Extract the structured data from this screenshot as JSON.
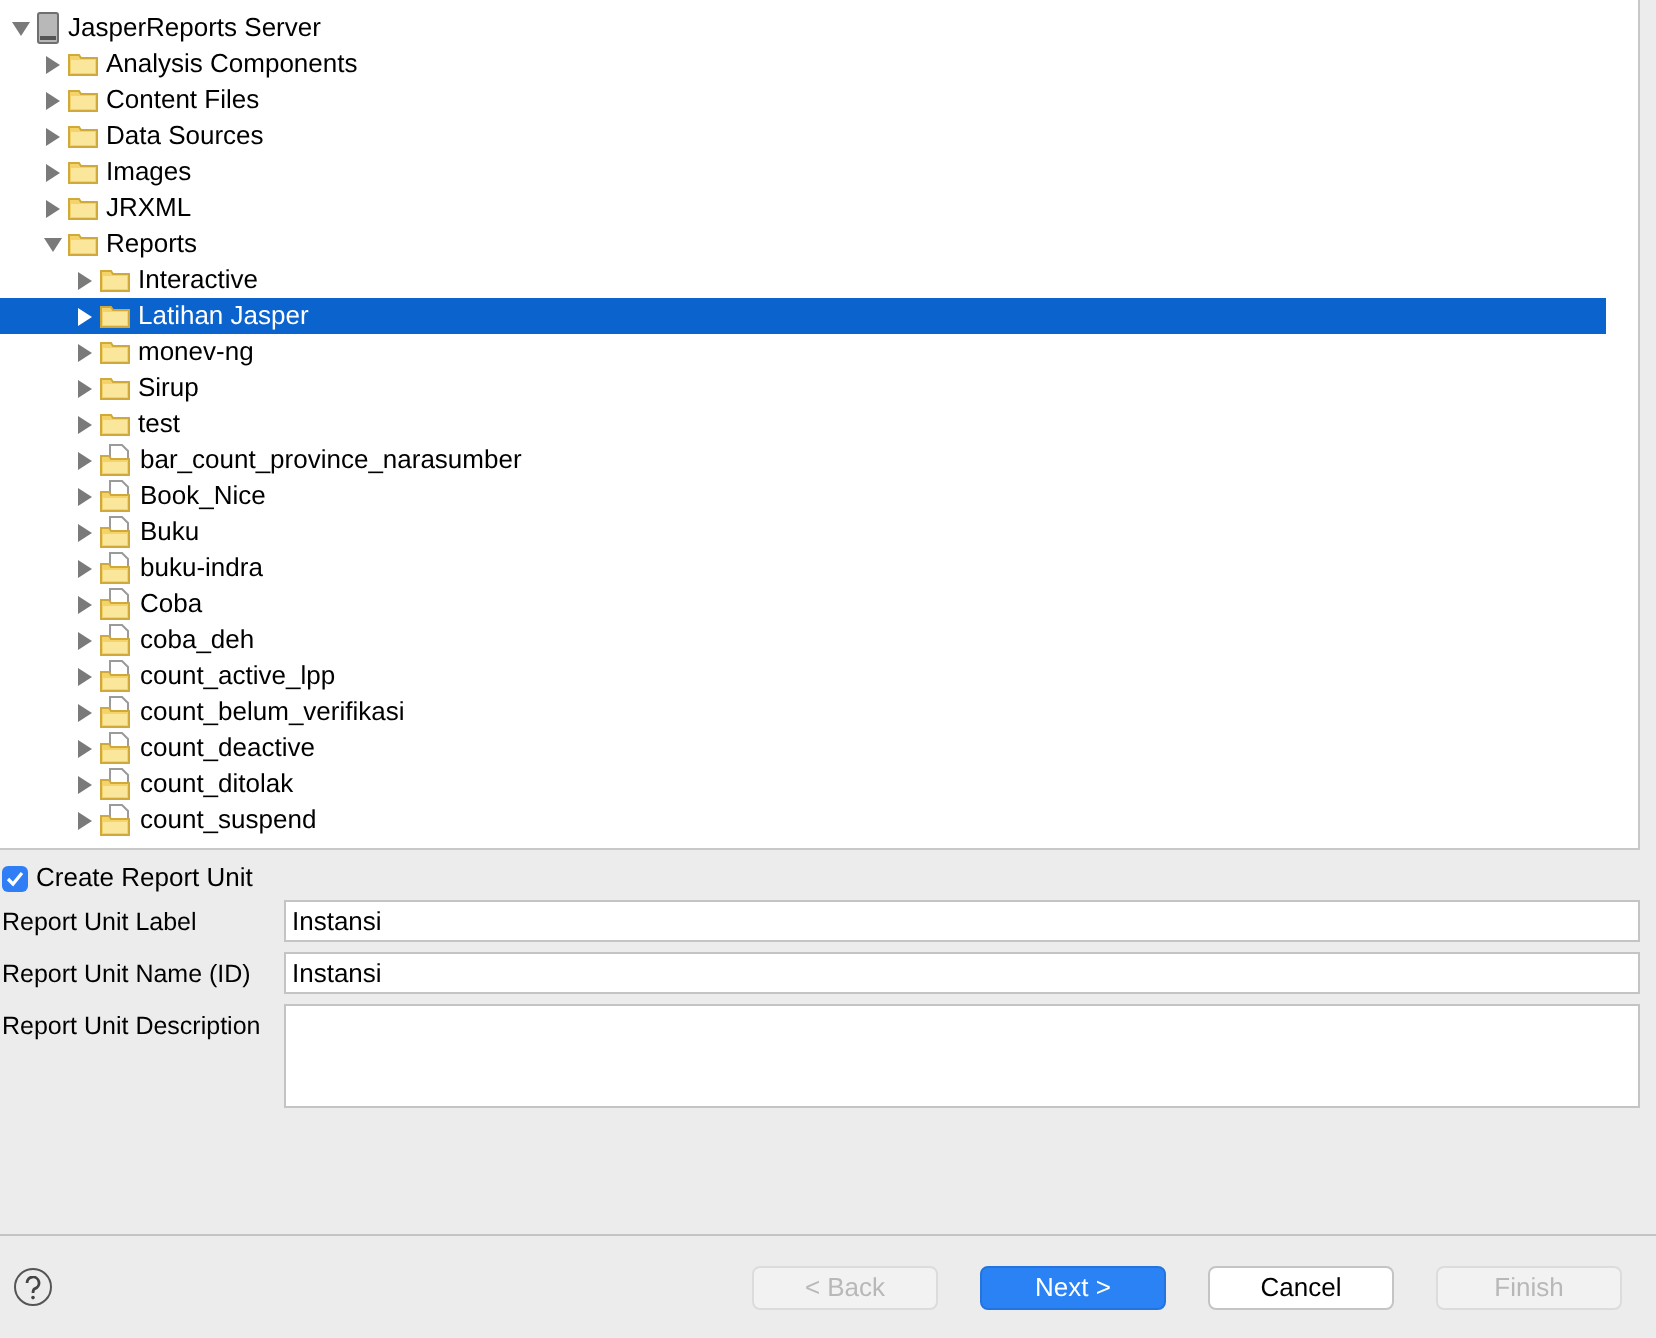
{
  "tree": [
    {
      "label": "JasperReports Server",
      "kind": "server",
      "expanded": true,
      "selected": false,
      "children": [
        {
          "label": "Analysis Components",
          "kind": "folder",
          "expanded": false,
          "selected": false
        },
        {
          "label": "Content Files",
          "kind": "folder",
          "expanded": false,
          "selected": false
        },
        {
          "label": "Data Sources",
          "kind": "folder",
          "expanded": false,
          "selected": false
        },
        {
          "label": "Images",
          "kind": "folder",
          "expanded": false,
          "selected": false
        },
        {
          "label": "JRXML",
          "kind": "folder",
          "expanded": false,
          "selected": false
        },
        {
          "label": "Reports",
          "kind": "folder",
          "expanded": true,
          "selected": false,
          "children": [
            {
              "label": "Interactive",
              "kind": "folder",
              "expanded": false,
              "selected": false
            },
            {
              "label": "Latihan Jasper",
              "kind": "folder",
              "expanded": false,
              "selected": true
            },
            {
              "label": "monev-ng",
              "kind": "folder",
              "expanded": false,
              "selected": false
            },
            {
              "label": "Sirup",
              "kind": "folder",
              "expanded": false,
              "selected": false
            },
            {
              "label": "test",
              "kind": "folder",
              "expanded": false,
              "selected": false
            },
            {
              "label": "bar_count_province_narasumber",
              "kind": "report",
              "expanded": false,
              "selected": false
            },
            {
              "label": "Book_Nice",
              "kind": "report",
              "expanded": false,
              "selected": false
            },
            {
              "label": "Buku",
              "kind": "report",
              "expanded": false,
              "selected": false
            },
            {
              "label": "buku-indra",
              "kind": "report",
              "expanded": false,
              "selected": false
            },
            {
              "label": "Coba",
              "kind": "report",
              "expanded": false,
              "selected": false
            },
            {
              "label": "coba_deh",
              "kind": "report",
              "expanded": false,
              "selected": false
            },
            {
              "label": "count_active_lpp",
              "kind": "report",
              "expanded": false,
              "selected": false
            },
            {
              "label": "count_belum_verifikasi",
              "kind": "report",
              "expanded": false,
              "selected": false
            },
            {
              "label": "count_deactive",
              "kind": "report",
              "expanded": false,
              "selected": false
            },
            {
              "label": "count_ditolak",
              "kind": "report",
              "expanded": false,
              "selected": false
            },
            {
              "label": "count_suspend",
              "kind": "report",
              "expanded": false,
              "selected": false
            }
          ]
        }
      ]
    }
  ],
  "create_report_unit": {
    "label": "Create Report Unit",
    "checked": true
  },
  "fields": [
    {
      "label": "Report Unit Label",
      "value": "Instansi",
      "kind": "text"
    },
    {
      "label": "Report Unit Name (ID)",
      "value": "Instansi",
      "kind": "text"
    },
    {
      "label": "Report Unit Description",
      "kind": "textarea"
    }
  ],
  "buttons": [
    {
      "label": "< Back",
      "disabled": true
    },
    {
      "label": "Next >",
      "disabled": false,
      "default": true
    },
    {
      "label": "Cancel",
      "disabled": false,
      "default": false
    },
    {
      "label": "Finish",
      "disabled": true
    }
  ]
}
